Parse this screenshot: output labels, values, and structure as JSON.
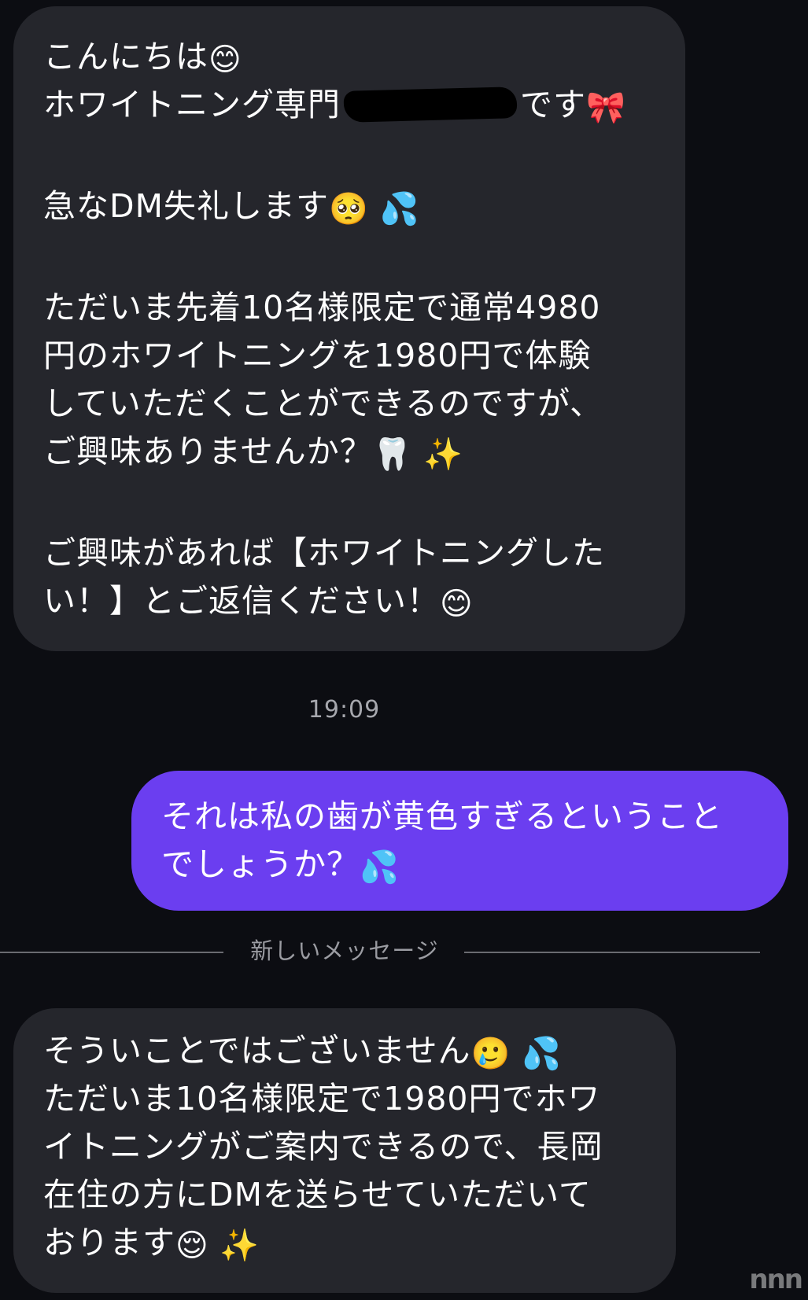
{
  "colors": {
    "background": "#0c0d12",
    "incoming_bubble": "#25262c",
    "outgoing_bubble": "#6b3ef0",
    "text": "#ffffff",
    "meta_text": "#a6a7ad"
  },
  "messages": {
    "first": {
      "line1": "こんにちは",
      "line1_emoji": "😊",
      "line2_start": "ホワイトニング専門",
      "line2_end": "です",
      "line2_emoji": "🎀",
      "line3": "急なDM失礼します",
      "line3_emoji": "🥺 💦",
      "line4": "ただいま先着10名様限定で通常4980",
      "line5": "円のホワイトニングを1980円で体験",
      "line6": "していただくことができるのですが、",
      "line7": "ご興味ありませんか？",
      "line7_emoji": "🦷 ✨",
      "line8": "ご興味があれば【ホワイトニングした",
      "line9": "い！】とご返信ください！",
      "line9_emoji": "😊"
    },
    "timestamp": "19:09",
    "reply": {
      "line1": "それは私の歯が黄色すぎるということ",
      "line2": "でしょうか？",
      "line2_emoji": "💦"
    },
    "divider_label": "新しいメッセージ",
    "second": {
      "line1": "そういことではございません",
      "line1_emoji": "🥲 💦",
      "line2": "ただいま10名様限定で1980円でホワ",
      "line3": "イトニングがご案内できるので、長岡",
      "line4": "在住の方にDMを送らせていただいて",
      "line5": "おります",
      "line5_emoji": "😌 ✨"
    }
  },
  "watermark": "nnn"
}
